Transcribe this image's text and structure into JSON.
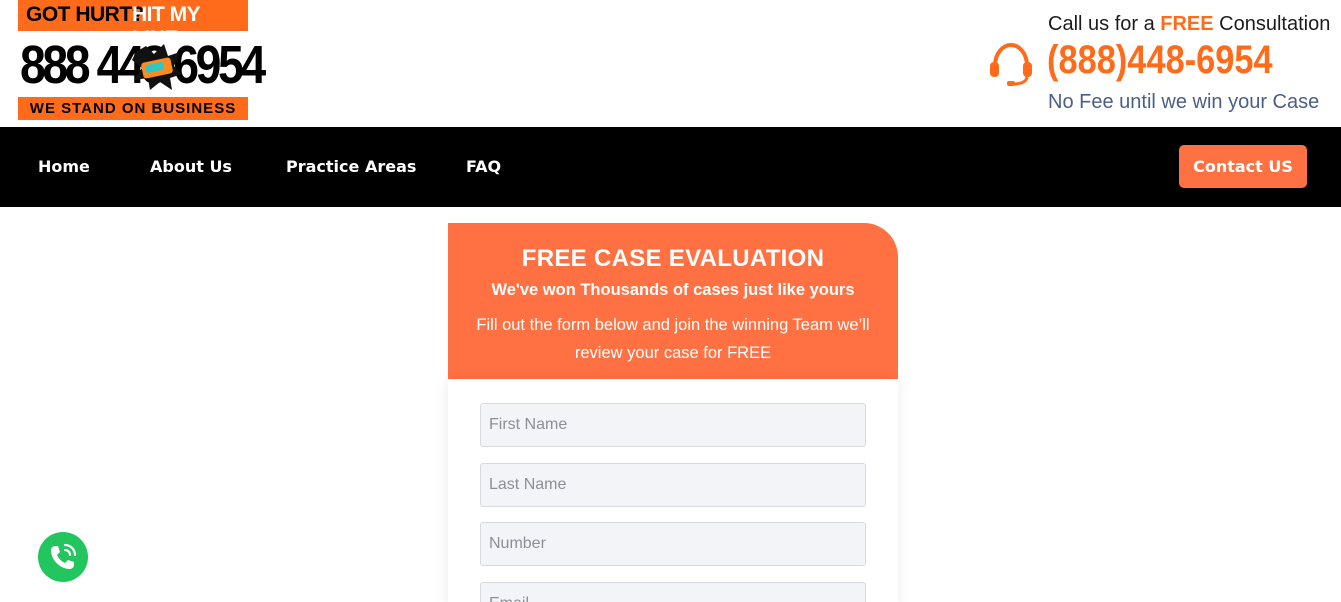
{
  "logo": {
    "top_left": "GOT HURT?",
    "top_right": "HIT MY LINE",
    "number": "888 448 6954",
    "bottom": "WE STAND ON BUSINESS"
  },
  "header": {
    "call_prefix": "Call us for a ",
    "call_free": "FREE",
    "call_suffix": " Consultation",
    "phone": "(888)448-6954",
    "no_fee": "No Fee until we win your Case"
  },
  "nav": {
    "items": [
      "Home",
      "About Us",
      "Practice Areas",
      "FAQ"
    ],
    "contact_label": "Contact US"
  },
  "evaluation": {
    "title": "FREE CASE EVALUATION",
    "subtitle": "We've won Thousands of cases just like yours",
    "description": "Fill out the form below and join the winning Team we’ll review your case for FREE"
  },
  "form": {
    "first_name_placeholder": "First Name",
    "last_name_placeholder": "Last Name",
    "number_placeholder": "Number",
    "email_placeholder": "Email"
  },
  "colors": {
    "accent": "#ff7142",
    "brand_orange": "#ff6b1a",
    "nav_bg": "#000000",
    "fab_green": "#22c55e"
  },
  "icons": {
    "headset": "headset-icon",
    "phone_fab": "phone-call-icon"
  }
}
